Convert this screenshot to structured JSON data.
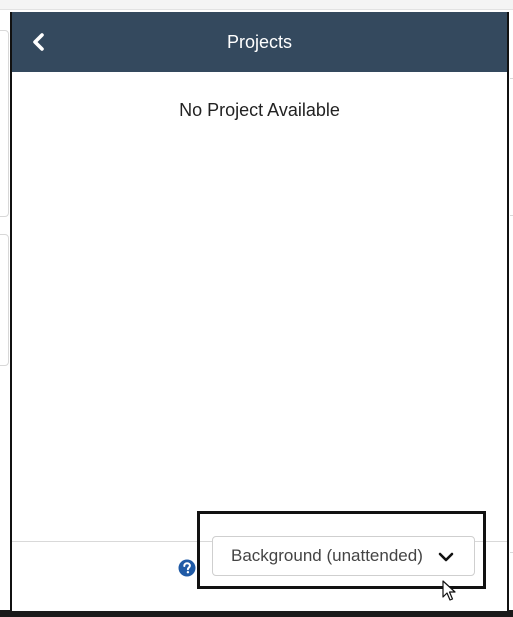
{
  "dialog": {
    "title": "Projects",
    "back_icon": "chevron-left-icon",
    "empty_message": "No Project Available"
  },
  "footer": {
    "help_icon": "question-circle-icon",
    "run_mode_select": {
      "selected": "Background (unattended)",
      "icon": "chevron-down-icon"
    }
  },
  "colors": {
    "header_background": "#34495e",
    "header_text": "#ffffff",
    "help_icon": "#1f5aa6",
    "highlight_border": "#111111"
  }
}
